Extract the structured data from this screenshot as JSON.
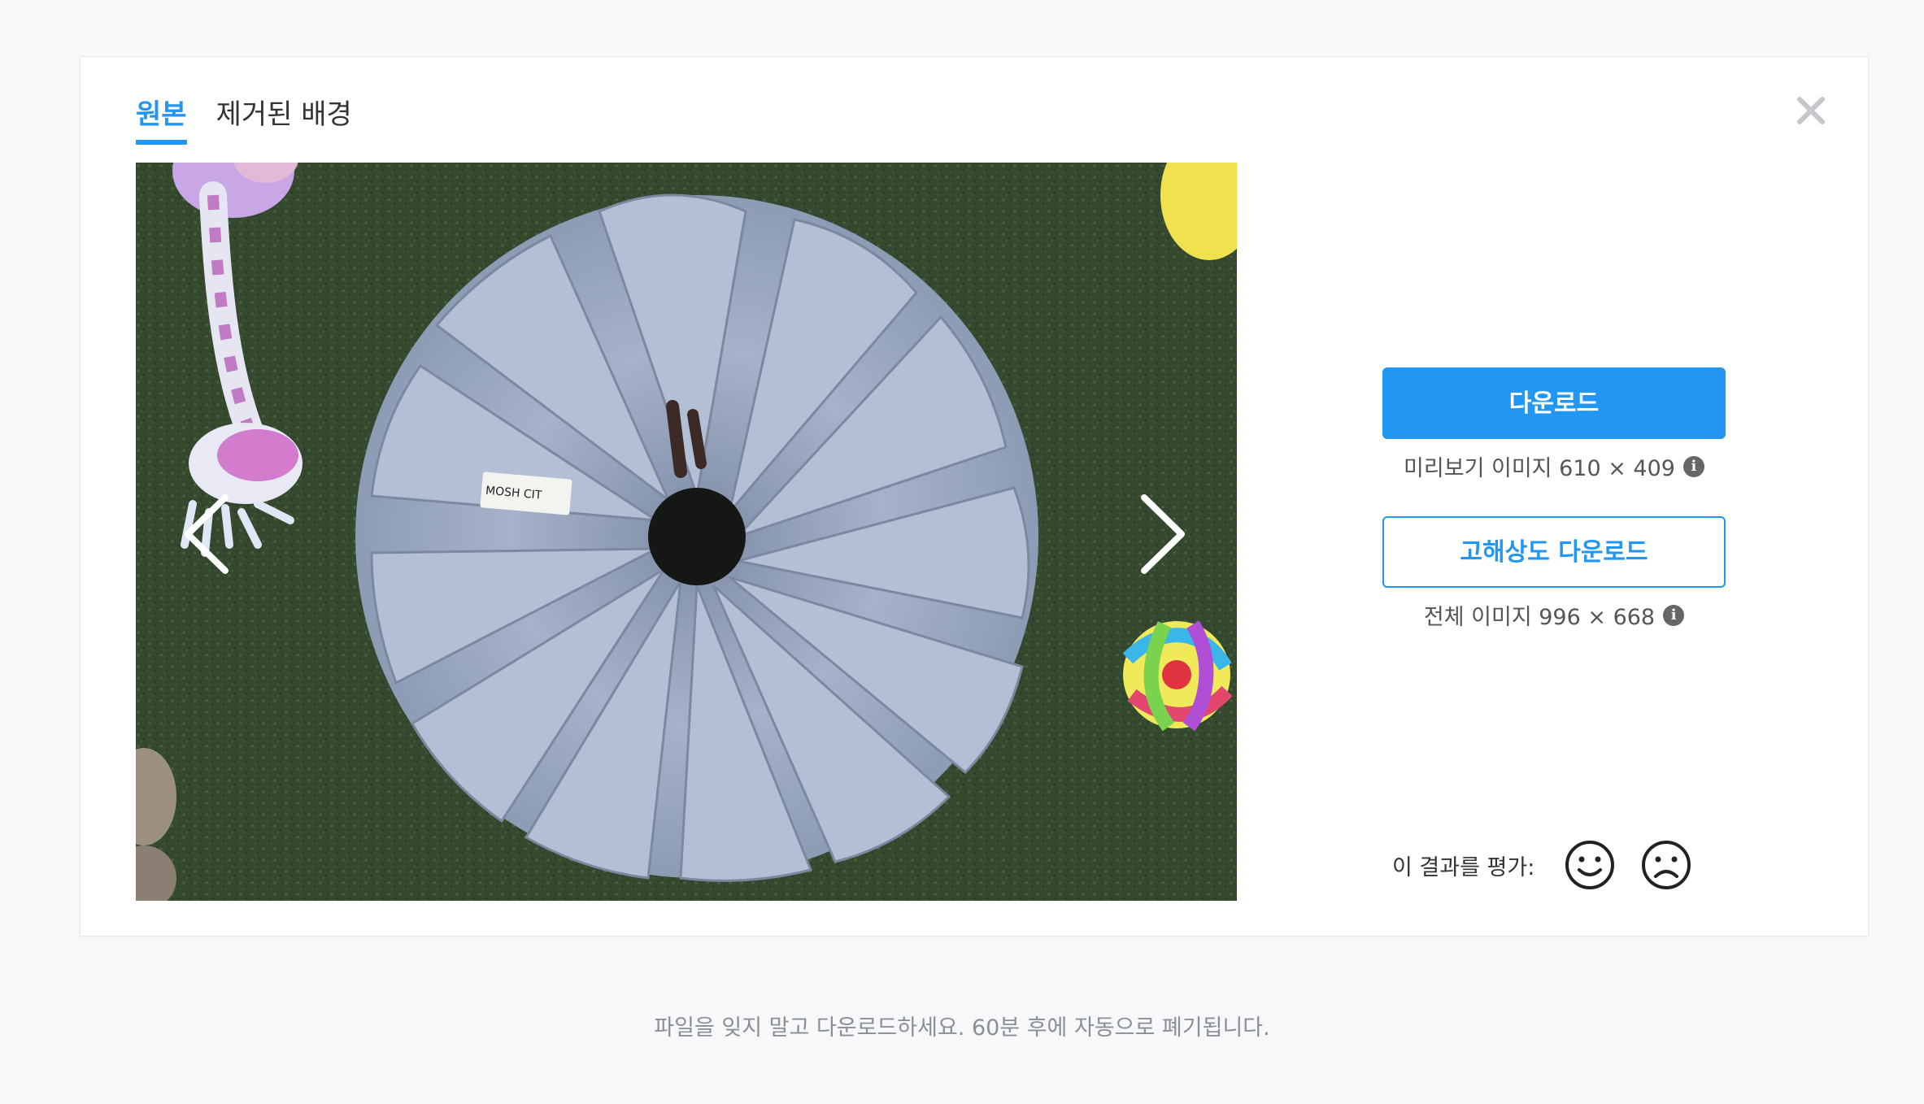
{
  "tabs": [
    {
      "label": "원본",
      "active": true
    },
    {
      "label": "제거된 배경",
      "active": false
    }
  ],
  "actions": {
    "download_label": "다운로드",
    "preview_info": "미리보기 이미지 610 × 409",
    "hd_download_label": "고해상도 다운로드",
    "full_info": "전체 이미지 996 × 668"
  },
  "rating": {
    "label": "이 결과를 평가:",
    "options": [
      "smile-icon",
      "frown-icon"
    ]
  },
  "footer": {
    "notice": "파일을 잊지 말고 다운로드하세요. 60분 후에 자동으로 폐기됩니다."
  },
  "image": {
    "label_text": "MOSH CIT"
  },
  "colors": {
    "accent": "#2196f3",
    "background": "#f7f8fa",
    "grass": "#35492f",
    "fabric": "#9eacc4"
  },
  "icons": [
    "close-icon",
    "chevron-left-icon",
    "chevron-right-icon",
    "info-icon"
  ]
}
